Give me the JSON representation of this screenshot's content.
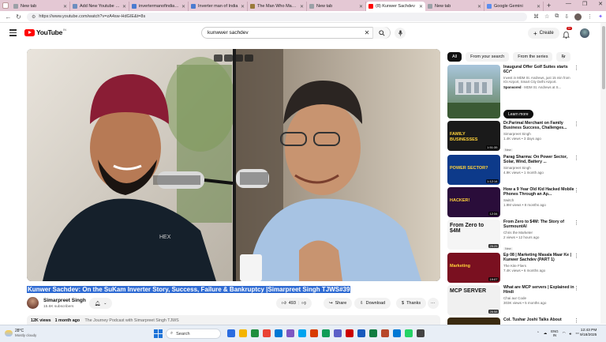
{
  "browser": {
    "tabs": [
      {
        "title": "New tab",
        "color": "#9aa0a6"
      },
      {
        "title": "Add New Youtube - Ku",
        "color": "#6c8ebf"
      },
      {
        "title": "invertermanofindia.co",
        "color": "#4a7bd0"
      },
      {
        "title": "Inverter man of India",
        "color": "#4a7bd0"
      },
      {
        "title": "The Man Who Made In",
        "color": "#9a7a3a"
      },
      {
        "title": "New tab",
        "color": "#9aa0a6"
      },
      {
        "title": "(8) Kunwer Sachdev",
        "color": "#ff0000",
        "active": true
      },
      {
        "title": "New tab",
        "color": "#9aa0a6"
      },
      {
        "title": "Google Gemini",
        "color": "#5b8def"
      }
    ],
    "url": "https://www.youtube.com/watch?v=zA4sw-HdGIE&t=8s"
  },
  "youtube": {
    "logo_text": "YouTube",
    "country_code": "IN",
    "search_query": "kunwwer sachdev",
    "create_label": "Create",
    "notification_count": "9+"
  },
  "video": {
    "title": "Kunwer Sachdev: On the SuKam Inverter Story, Success, Failure & Bankruptcy |Simarpreet Singh TJWS#39",
    "channel_name": "Simarpreet Singh",
    "subscribers": "15.6K subscribers",
    "likes": "493",
    "share_label": "Share",
    "download_label": "Download",
    "thanks_label": "Thanks",
    "views": "12K views",
    "age": "1 month ago",
    "description": "The Journey Podcast with Simarpreet Singh TJWS"
  },
  "chips": [
    "All",
    "From your search",
    "From the series",
    "Fr"
  ],
  "ad": {
    "title": "Inaugural Offer Golf Suites starts 6Cr*",
    "desc": "Invest in MDM St. Andrews, just 15 min from IGI Airport, Smart City Delhi Airport.",
    "sponsored_label": "Sponsored",
    "advertiser": "MDM St. Andrews at S...",
    "cta": "Learn more"
  },
  "recommendations": [
    {
      "title": "Dr.Parimal Merchant on Family Business Success, Challenges...",
      "channel": "Simarpreet Singh",
      "stats": "1.4K views • 3 days ago",
      "duration": "1:51:35",
      "badge": "New",
      "thumb_text": "FAMILY BUSINESSES",
      "thumb_color": "#1a1a1a"
    },
    {
      "title": "Parag Sharma: On Power Sector, Solar, Wind, Battery ...",
      "channel": "Simarpreet Singh",
      "stats": "4.9K views • 1 month ago",
      "duration": "1:12:14",
      "badge": "",
      "thumb_text": "POWER SECTOR?",
      "thumb_color": "#0d3a8a"
    },
    {
      "title": "How a 9 Year Old Kid Hacked Mobile Phones Through an Ap...",
      "channel": "Switch",
      "stats": "1.9M views • 8 months ago",
      "duration": "12:34",
      "badge": "",
      "thumb_text": "HACKER!",
      "thumb_color": "#2a0d3a"
    },
    {
      "title": "From Zero to $4M: The Story of SurmountAI",
      "channel": "Chris the Marketer",
      "stats": "2 views • 12 hours ago",
      "duration": "25:25",
      "badge": "New",
      "thumb_text": "From Zero to $4M",
      "thumb_color": "#f5f5f5"
    },
    {
      "title": "Ep 08 | Marketing Masala Maar Ke | Kunwer Sachdev (PART 1)",
      "channel": "The Kite Fliers",
      "stats": "7.4K views • 6 months ago",
      "duration": "19:07",
      "badge": "",
      "thumb_text": "Marketing",
      "thumb_color": "#7a1020"
    },
    {
      "title": "What are MCP servers | Explained in Hindi",
      "channel": "Chai aur Code",
      "stats": "303K views • 5 months ago",
      "duration": "26:58",
      "badge": "",
      "thumb_text": "MCP SERVER",
      "thumb_color": "#f0f0f0"
    },
    {
      "title": "Col. Tushar Joshi Talks About",
      "channel": "",
      "stats": "",
      "duration": "",
      "badge": "",
      "thumb_text": "NSG OPERATION",
      "thumb_color": "#3a2a10"
    }
  ],
  "taskbar": {
    "temperature": "28°C",
    "condition": "Mostly cloudy",
    "search_label": "Search",
    "lang_1": "ENG",
    "lang_2": "IN",
    "time": "12:43 PM",
    "date": "9/18/2025"
  }
}
